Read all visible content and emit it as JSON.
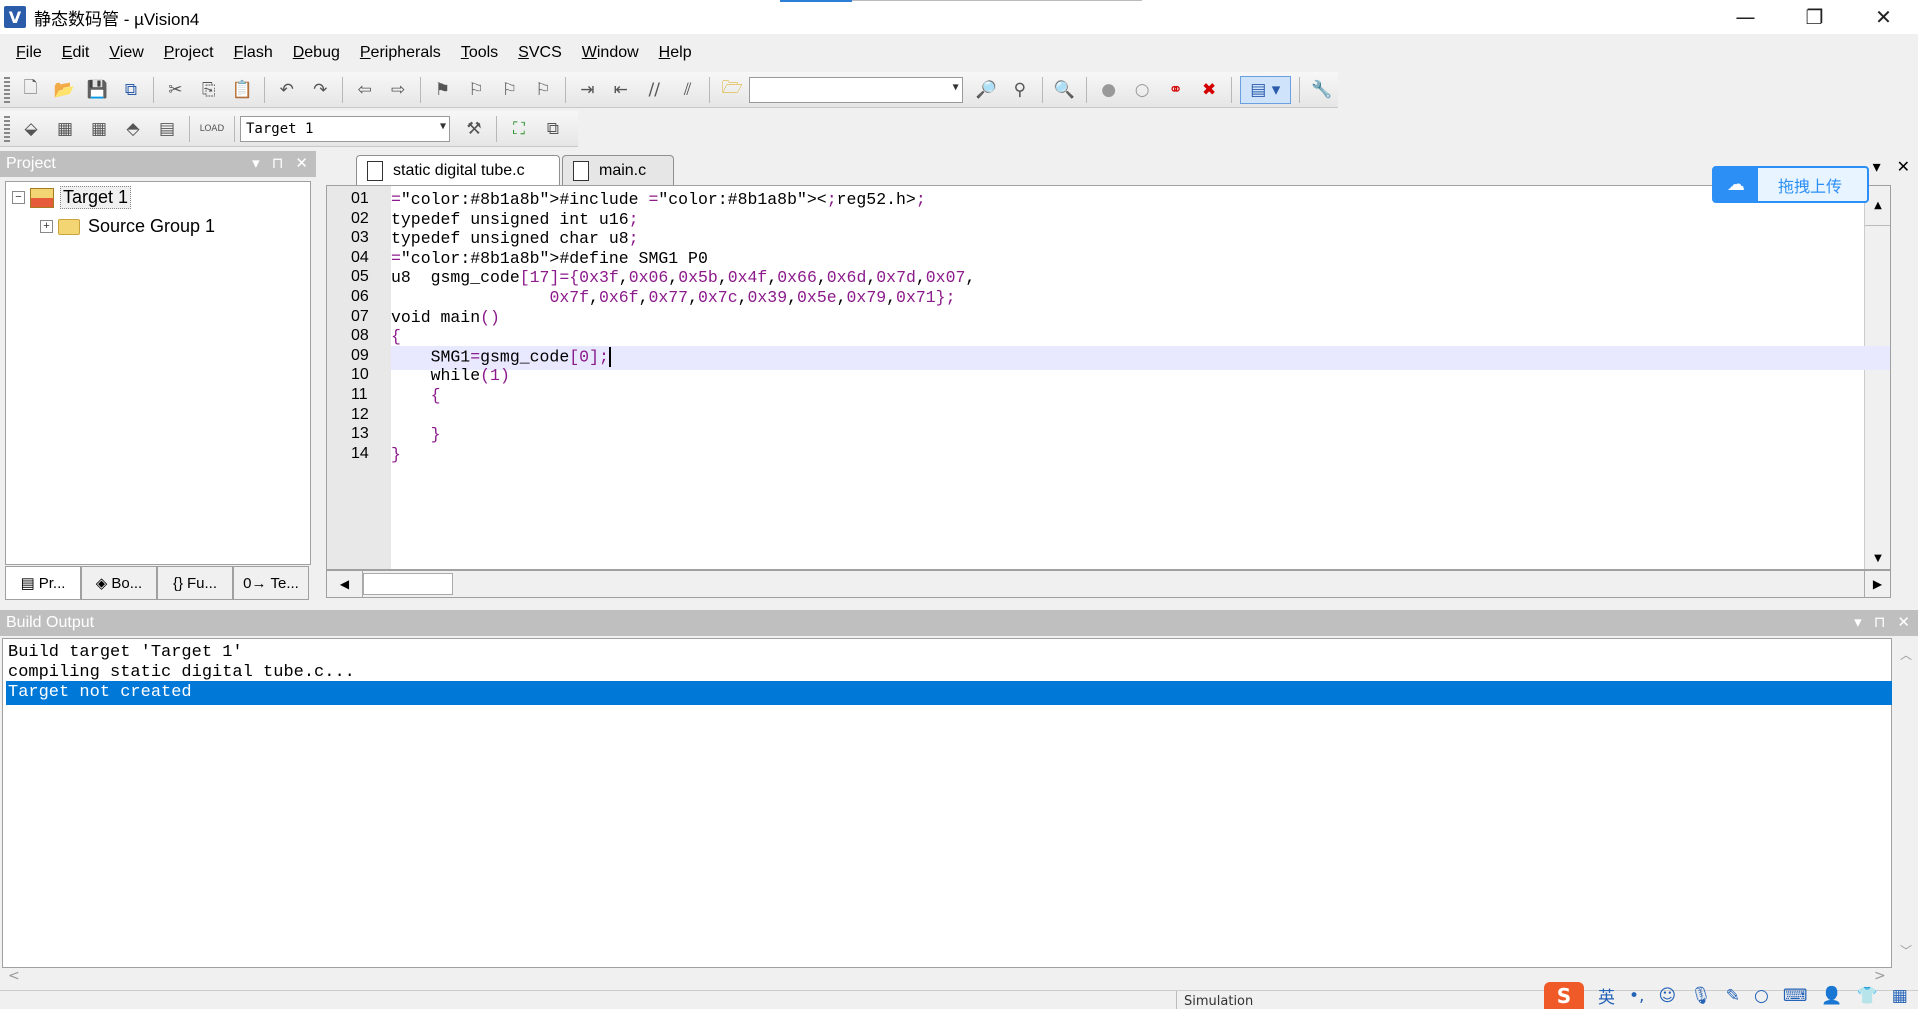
{
  "window": {
    "title": "静态数码管  - µVision4",
    "app_icon_letter": "V",
    "minimize": "—",
    "restore": "❐",
    "close": "✕"
  },
  "menu": [
    {
      "label": "File",
      "accel": "F",
      "rest": "ile"
    },
    {
      "label": "Edit",
      "accel": "E",
      "rest": "dit"
    },
    {
      "label": "View",
      "accel": "V",
      "rest": "iew"
    },
    {
      "label": "Project",
      "accel": "P",
      "rest": "roject"
    },
    {
      "label": "Flash",
      "accel": "F",
      "rest": "lash"
    },
    {
      "label": "Debug",
      "accel": "D",
      "rest": "ebug"
    },
    {
      "label": "Peripherals",
      "accel": "P",
      "rest": "eripherals"
    },
    {
      "label": "Tools",
      "accel": "T",
      "rest": "ools"
    },
    {
      "label": "SVCS",
      "accel": "S",
      "rest": "VCS"
    },
    {
      "label": "Window",
      "accel": "W",
      "rest": "indow"
    },
    {
      "label": "Help",
      "accel": "H",
      "rest": "elp"
    }
  ],
  "toolbar": {
    "find_combo_value": "",
    "target_combo_value": "Target 1"
  },
  "project_pane": {
    "title": "Project",
    "ctrl_dropdown": "▾",
    "ctrl_pin": "⊓",
    "ctrl_close": "✕",
    "tree": {
      "target_label": "Target 1",
      "target_expander": "−",
      "group_label": "Source Group 1",
      "group_expander": "+"
    },
    "tabs": [
      {
        "icon": "▤",
        "label": "Pr..."
      },
      {
        "icon": "◈",
        "label": "Bo..."
      },
      {
        "icon": "{}",
        "label": "Fu..."
      },
      {
        "icon": "0→",
        "label": "Te..."
      }
    ]
  },
  "editor": {
    "tabs": [
      {
        "label": "static digital tube.c",
        "active": true
      },
      {
        "label": "main.c",
        "active": false
      }
    ],
    "ctrl_dropdown": "▾",
    "ctrl_close": "✕",
    "upload_button_label": "拖拽上传",
    "upload_icon": "☁",
    "lines": [
      {
        "num": "01",
        "text": "#include <reg52.h>"
      },
      {
        "num": "02",
        "text": "typedef unsigned int u16;"
      },
      {
        "num": "03",
        "text": "typedef unsigned char u8;"
      },
      {
        "num": "04",
        "text": "#define SMG1 P0"
      },
      {
        "num": "05",
        "text": "u8  gsmg_code[17]={0x3f,0x06,0x5b,0x4f,0x66,0x6d,0x7d,0x07,"
      },
      {
        "num": "06",
        "text": "                0x7f,0x6f,0x77,0x7c,0x39,0x5e,0x79,0x71};"
      },
      {
        "num": "07",
        "text": "void main()"
      },
      {
        "num": "08",
        "text": "{"
      },
      {
        "num": "09",
        "text": "    SMG1=gsmg_code[0];"
      },
      {
        "num": "10",
        "text": "    while(1)"
      },
      {
        "num": "11",
        "text": "    {"
      },
      {
        "num": "12",
        "text": ""
      },
      {
        "num": "13",
        "text": "    }"
      },
      {
        "num": "14",
        "text": "}"
      }
    ],
    "current_line": "09"
  },
  "build_output": {
    "title": "Build Output",
    "ctrl_dropdown": "▾",
    "ctrl_pin": "⊓",
    "ctrl_close": "✕",
    "lines": [
      "Build target 'Target 1'",
      "compiling static digital tube.c...",
      "Target not created"
    ],
    "selected_index": 2
  },
  "statusbar": {
    "mode": "Simulation"
  },
  "ime": {
    "logo": "S",
    "lang": "英",
    "punct": "•,",
    "emoji": "☺",
    "mic": "🎙",
    "pen": "✎",
    "search": "○",
    "keyboard": "⌨",
    "user": "👤",
    "shirt": "👕",
    "grid": "▦"
  },
  "colors": {
    "selection": "#0078d7",
    "current_line": "#e8e8ff",
    "preprocessor": "#8b1a8b",
    "baidu_blue": "#2c8ff5"
  }
}
